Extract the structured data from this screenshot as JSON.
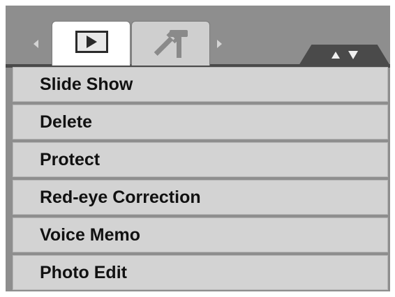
{
  "tabs": [
    {
      "name": "playback",
      "icon": "play-icon",
      "active": true
    },
    {
      "name": "setup",
      "icon": "tools-icon",
      "active": false
    }
  ],
  "menu": {
    "items": [
      {
        "label": "Slide Show"
      },
      {
        "label": "Delete"
      },
      {
        "label": "Protect"
      },
      {
        "label": "Red-eye Correction"
      },
      {
        "label": "Voice Memo"
      },
      {
        "label": "Photo Edit"
      }
    ]
  },
  "colors": {
    "background": "#8e8e8e",
    "item": "#d3d3d3",
    "active_tab": "#ffffff",
    "text": "#111111"
  }
}
